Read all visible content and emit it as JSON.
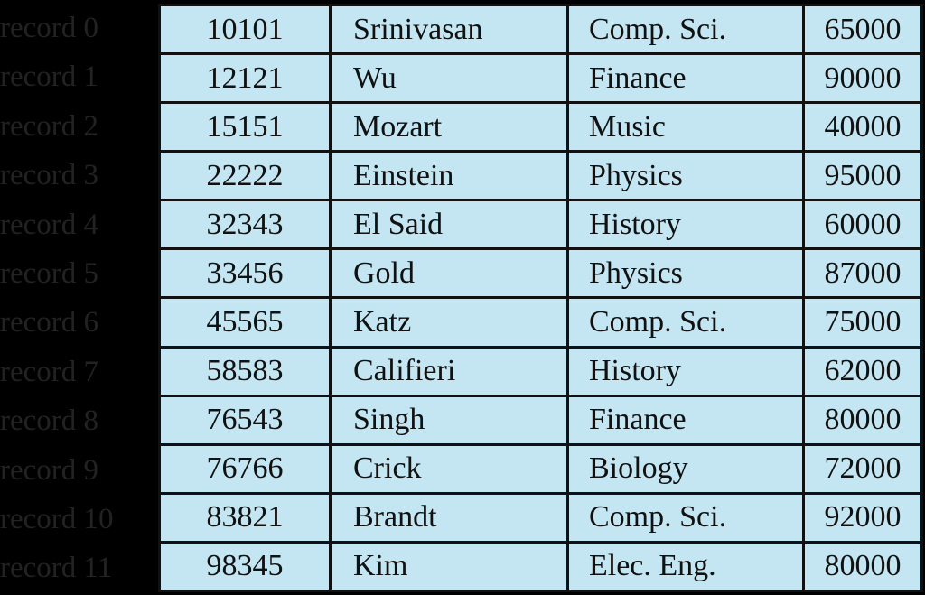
{
  "records": [
    {
      "label": "record 0",
      "id": "10101",
      "name": "Srinivasan",
      "dept": "Comp. Sci.",
      "salary": "65000"
    },
    {
      "label": "record 1",
      "id": "12121",
      "name": "Wu",
      "dept": "Finance",
      "salary": "90000"
    },
    {
      "label": "record 2",
      "id": "15151",
      "name": "Mozart",
      "dept": "Music",
      "salary": "40000"
    },
    {
      "label": "record 3",
      "id": "22222",
      "name": "Einstein",
      "dept": "Physics",
      "salary": "95000"
    },
    {
      "label": "record 4",
      "id": "32343",
      "name": "El Said",
      "dept": "History",
      "salary": "60000"
    },
    {
      "label": "record 5",
      "id": "33456",
      "name": "Gold",
      "dept": "Physics",
      "salary": "87000"
    },
    {
      "label": "record 6",
      "id": "45565",
      "name": "Katz",
      "dept": "Comp. Sci.",
      "salary": "75000"
    },
    {
      "label": "record 7",
      "id": "58583",
      "name": "Califieri",
      "dept": "History",
      "salary": "62000"
    },
    {
      "label": "record 8",
      "id": "76543",
      "name": "Singh",
      "dept": "Finance",
      "salary": "80000"
    },
    {
      "label": "record 9",
      "id": "76766",
      "name": "Crick",
      "dept": "Biology",
      "salary": "72000"
    },
    {
      "label": "record 10",
      "id": "83821",
      "name": "Brandt",
      "dept": "Comp. Sci.",
      "salary": "92000"
    },
    {
      "label": "record 11",
      "id": "98345",
      "name": "Kim",
      "dept": "Elec. Eng.",
      "salary": "80000"
    }
  ],
  "colors": {
    "cell": "#c3e6f2",
    "background": "#000000",
    "label": "#222222"
  }
}
